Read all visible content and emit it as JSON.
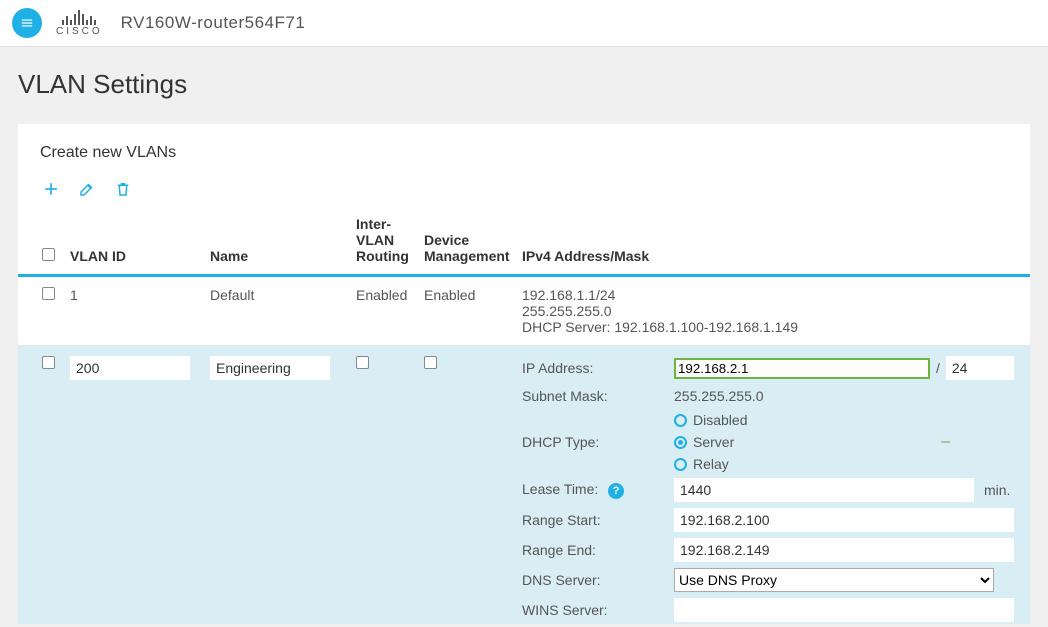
{
  "header": {
    "brand": "CISCO",
    "device_name": "RV160W-router564F71"
  },
  "page": {
    "title": "VLAN Settings",
    "section_title": "Create new VLANs"
  },
  "table": {
    "headers": {
      "vlan_id": "VLAN ID",
      "name": "Name",
      "inter_vlan_routing": "Inter-VLAN Routing",
      "device_management": "Device Management",
      "ipv4": "IPv4 Address/Mask"
    },
    "row_default": {
      "vlan_id": "1",
      "name": "Default",
      "ivr": "Enabled",
      "dm": "Enabled",
      "ip_line1": "192.168.1.1/24",
      "ip_line2": "255.255.255.0",
      "ip_line3": "DHCP Server: 192.168.1.100-192.168.1.149"
    },
    "row_edit": {
      "vlan_id": "200",
      "name": "Engineering",
      "ivr_checked": false,
      "dm_checked": false,
      "labels": {
        "ip_address": "IP Address:",
        "subnet_mask": "Subnet Mask:",
        "dhcp_type": "DHCP Type:",
        "lease_time": "Lease Time:",
        "lease_unit": "min.",
        "range_start": "Range Start:",
        "range_end": "Range End:",
        "dns_server": "DNS Server:",
        "wins_server": "WINS Server:"
      },
      "values": {
        "ip_address": "192.168.2.1",
        "cidr": "24",
        "subnet_mask": "255.255.255.0",
        "dhcp_options": {
          "disabled": "Disabled",
          "server": "Server",
          "relay": "Relay"
        },
        "dhcp_selected": "server",
        "lease_time": "1440",
        "range_start": "192.168.2.100",
        "range_end": "192.168.2.149",
        "dns_server_selected": "Use DNS Proxy",
        "wins_server": ""
      }
    }
  }
}
